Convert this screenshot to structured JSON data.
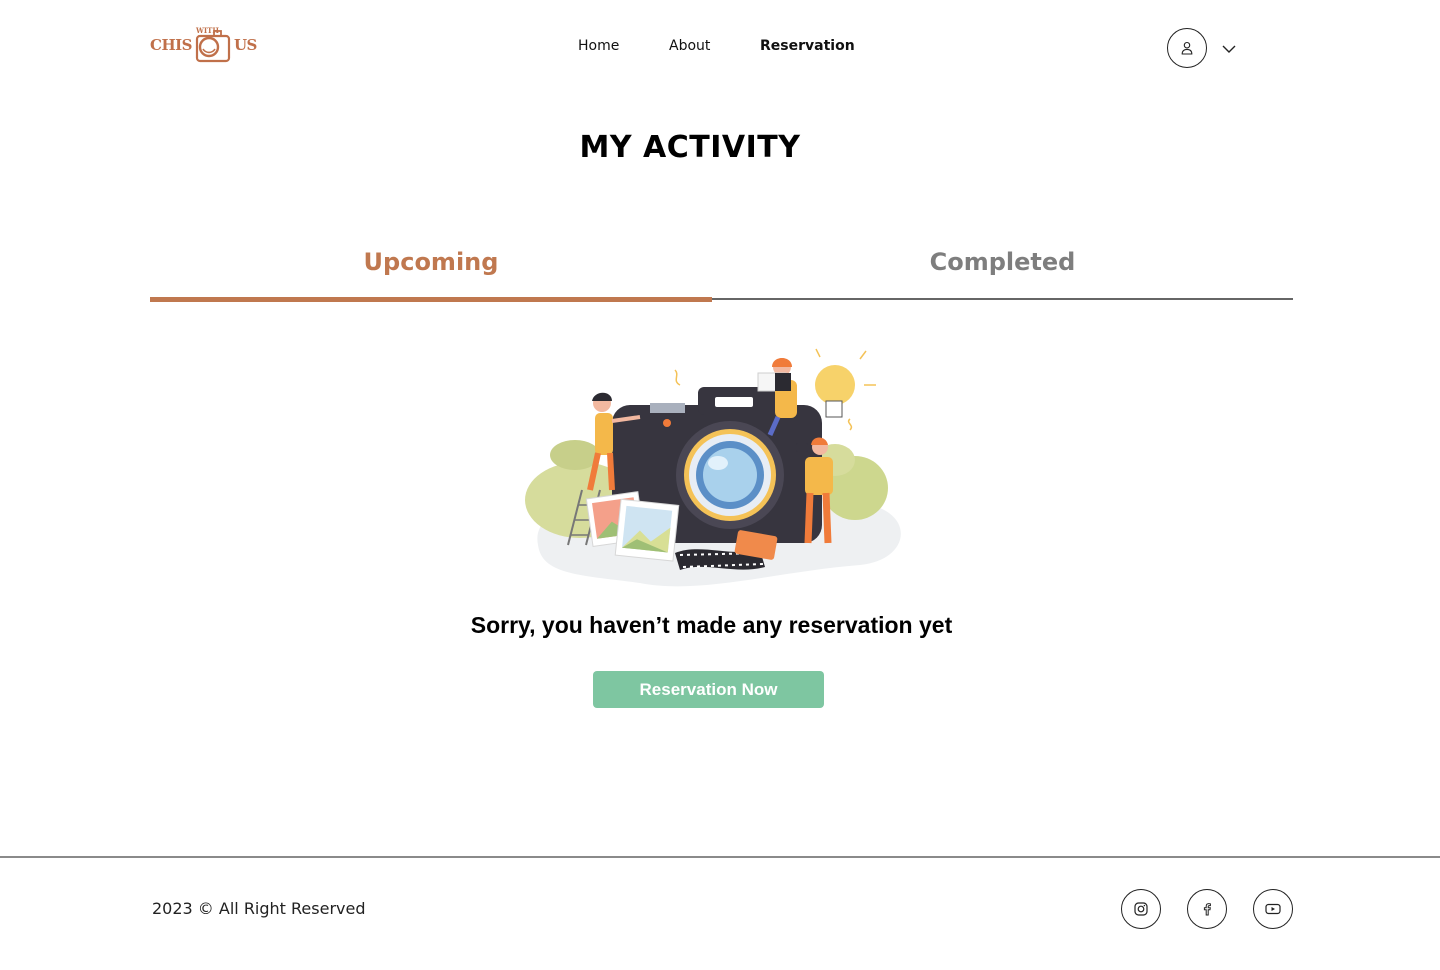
{
  "brand": {
    "word_left": "CHIS",
    "word_small": "WITH",
    "word_right": "US",
    "color": "#c0704a"
  },
  "nav": {
    "items": [
      {
        "label": "Home"
      },
      {
        "label": "About"
      },
      {
        "label": "Reservation",
        "active": true
      }
    ]
  },
  "user_menu": {
    "icon": "user-icon",
    "chevron": "chevron-down-icon"
  },
  "page": {
    "title": "MY ACTIVITY"
  },
  "tabs": [
    {
      "label": "Upcoming",
      "active": true,
      "color": "#c0784f"
    },
    {
      "label": "Completed",
      "active": false,
      "color": "#7e7e7e"
    }
  ],
  "empty_state": {
    "illustration": "camera-team-illustration",
    "message": "Sorry, you haven’t made any reservation yet",
    "button_label": "Reservation Now",
    "button_color": "#7ec6a1"
  },
  "footer": {
    "copyright": "2023 © All Right Reserved",
    "social": [
      {
        "icon": "instagram-icon"
      },
      {
        "icon": "facebook-icon"
      },
      {
        "icon": "youtube-icon"
      }
    ]
  }
}
